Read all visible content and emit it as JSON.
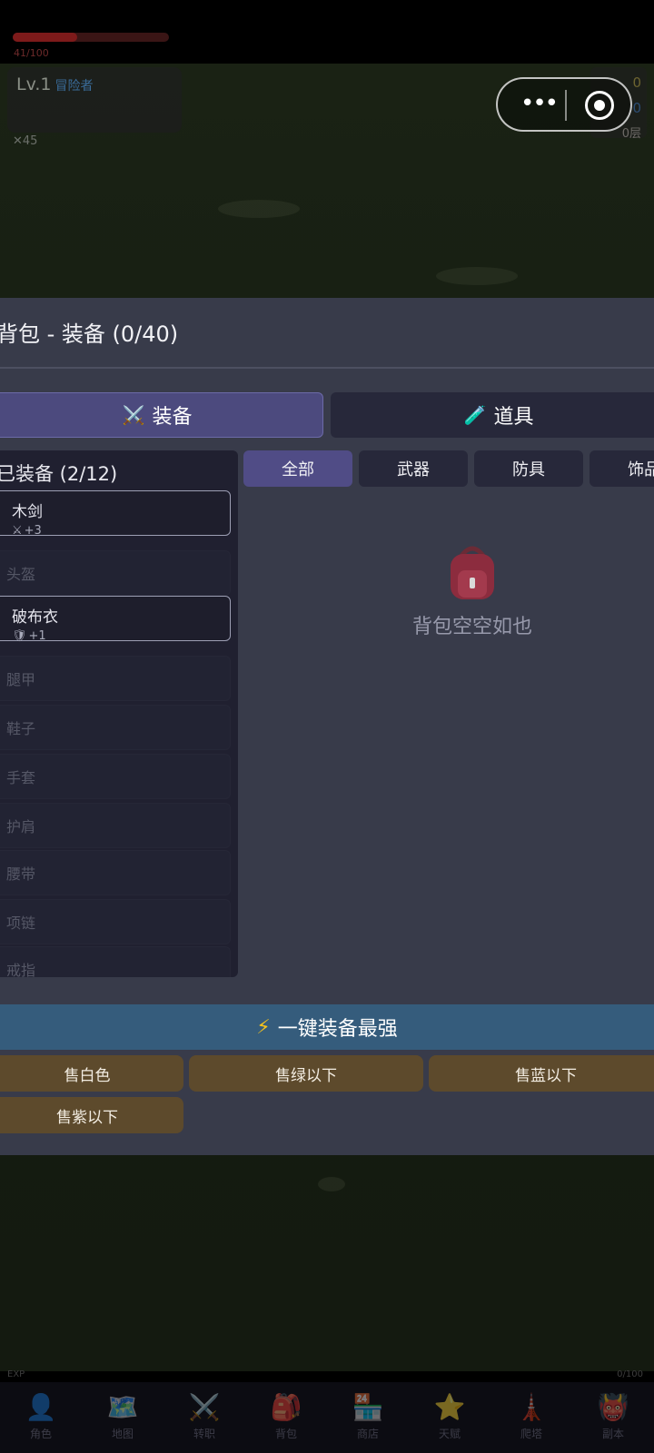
{
  "player": {
    "level": "Lv.1",
    "class": "冒险者",
    "hp_text": "41/100",
    "hp_fraction": 0.41,
    "attack": "45"
  },
  "resources": {
    "gold": "0",
    "gems": "0",
    "floor": "0层"
  },
  "modal": {
    "title": "背包 - 装备 (0/40)",
    "tabs": [
      {
        "icon": "⚔️",
        "label": "装备",
        "active": true
      },
      {
        "icon": "🧪",
        "label": "道具",
        "active": false
      }
    ],
    "equipped_title": "已装备 (2/12)",
    "slots": [
      {
        "label": "木剑",
        "stat": "+3",
        "stat_icon": "sword-icon",
        "filled": true
      },
      {
        "label": "头盔",
        "filled": false
      },
      {
        "label": "破布衣",
        "stat": "+1",
        "stat_icon": "shield-icon",
        "filled": true
      },
      {
        "label": "腿甲",
        "filled": false
      },
      {
        "label": "鞋子",
        "filled": false
      },
      {
        "label": "手套",
        "filled": false
      },
      {
        "label": "护肩",
        "filled": false
      },
      {
        "label": "腰带",
        "filled": false
      },
      {
        "label": "项链",
        "filled": false
      },
      {
        "label": "戒指",
        "filled": false
      }
    ],
    "filters": [
      "全部",
      "武器",
      "防具",
      "饰品"
    ],
    "empty_text": "背包空空如也",
    "equip_best": "一键装备最强",
    "sell_buttons": [
      "售白色",
      "售绿以下",
      "售蓝以下",
      "售紫以下"
    ]
  },
  "exp": {
    "label": "EXP",
    "value": "0/100"
  },
  "nav": [
    {
      "icon": "👤",
      "label": "角色"
    },
    {
      "icon": "🗺️",
      "label": "地图"
    },
    {
      "icon": "⚔️",
      "label": "转职"
    },
    {
      "icon": "🎒",
      "label": "背包"
    },
    {
      "icon": "🏪",
      "label": "商店"
    },
    {
      "icon": "⭐",
      "label": "天赋"
    },
    {
      "icon": "🗼",
      "label": "爬塔"
    },
    {
      "icon": "👹",
      "label": "副本"
    }
  ]
}
